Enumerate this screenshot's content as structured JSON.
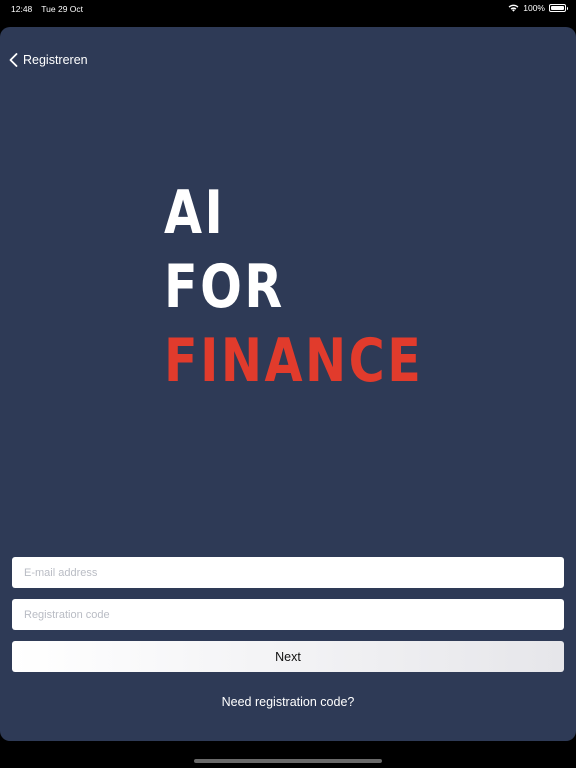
{
  "status_bar": {
    "time": "12:48",
    "date": "Tue 29 Oct",
    "battery": "100%",
    "battery_level": 1.0
  },
  "nav": {
    "back_label": "Registreren",
    "back_icon": "chevron-left-icon"
  },
  "logo": {
    "line1": "AI",
    "line2": "FOR",
    "line3": "FINANCE",
    "colors": {
      "primary": "#ffffff",
      "accent": "#e13b2c"
    }
  },
  "form": {
    "email_placeholder": "E-mail address",
    "email_value": "",
    "code_placeholder": "Registration code",
    "code_value": "",
    "next_label": "Next",
    "need_code_label": "Need registration code?"
  },
  "colors": {
    "background": "#2e3a56",
    "frame": "#000000"
  }
}
